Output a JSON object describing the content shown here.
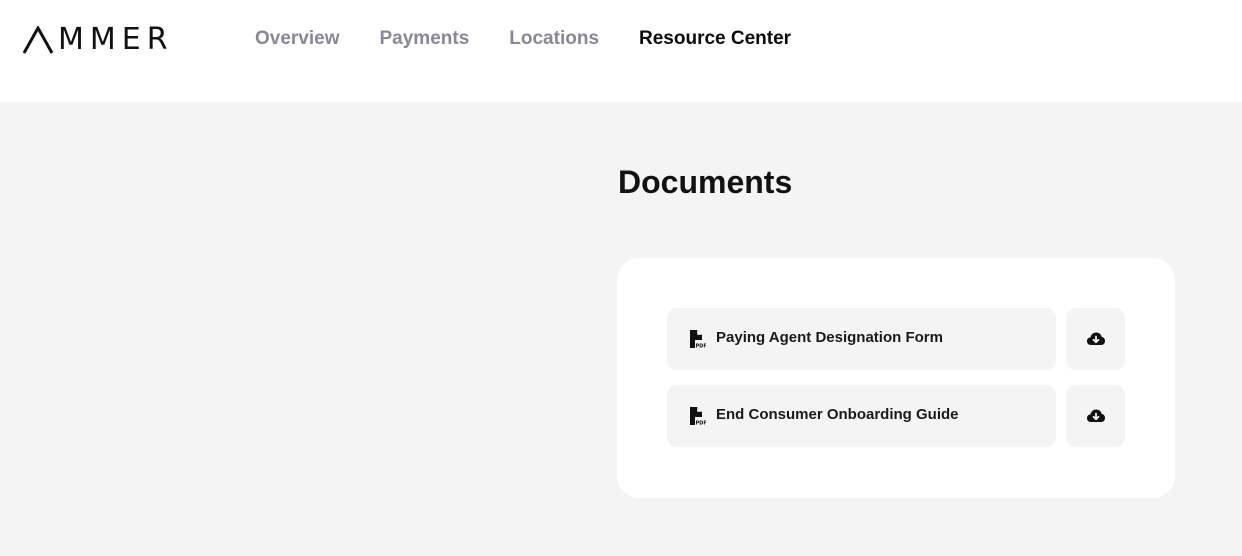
{
  "brand": {
    "logo_text": "MMER",
    "logo_full": "AMMER"
  },
  "nav": {
    "items": [
      {
        "label": "Overview",
        "active": false
      },
      {
        "label": "Payments",
        "active": false
      },
      {
        "label": "Locations",
        "active": false
      },
      {
        "label": "Resource Center",
        "active": true
      }
    ]
  },
  "main": {
    "title": "Documents",
    "documents": [
      {
        "name": "Paying Agent Designation Form",
        "icon": "pdf-file-icon",
        "action_icon": "cloud-download-icon"
      },
      {
        "name": "End Consumer Onboarding Guide",
        "icon": "pdf-file-icon",
        "action_icon": "cloud-download-icon"
      }
    ]
  },
  "colors": {
    "background": "#f4f4f4",
    "header": "#ffffff",
    "nav_inactive": "#8a8797",
    "nav_active": "#0c0c0c",
    "card": "#ffffff"
  }
}
